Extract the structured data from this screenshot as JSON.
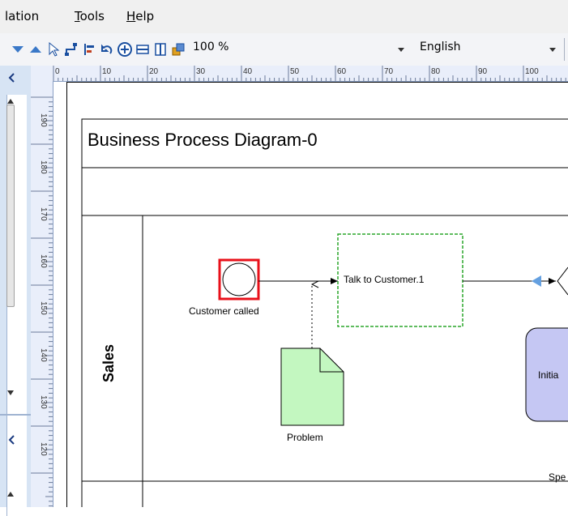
{
  "menu": {
    "items": [
      {
        "label": "lation",
        "underline": ""
      },
      {
        "label": "ools",
        "underline": "T"
      },
      {
        "label": "elp",
        "underline": "H"
      }
    ]
  },
  "toolbar": {
    "zoom_value": "100 %",
    "language_value": "English"
  },
  "ruler": {
    "horizontal_ticks": [
      "0",
      "10",
      "20",
      "30",
      "40",
      "50",
      "60",
      "70",
      "80",
      "90",
      "100"
    ],
    "vertical_ticks": [
      "190",
      "180",
      "170",
      "160",
      "150",
      "140",
      "130",
      "120"
    ]
  },
  "diagram": {
    "title": "Business Process Diagram-0",
    "lane_label": "Sales",
    "start_event_label": "Customer called",
    "task_label": "Talk to Customer.1",
    "artifact_label": "Problem",
    "partial_task_label": "Initia",
    "partial_bottom_label": "Spe"
  },
  "colors": {
    "selection_red": "#e8101a",
    "task_border_green": "#2aa52a",
    "artifact_fill": "#c3f7c0",
    "task_fill_lilac": "#c5c7f3",
    "arrow_blue": "#64a0e0",
    "ruler_bg": "#e9eefa",
    "panel_bg": "#d7e4f4"
  }
}
